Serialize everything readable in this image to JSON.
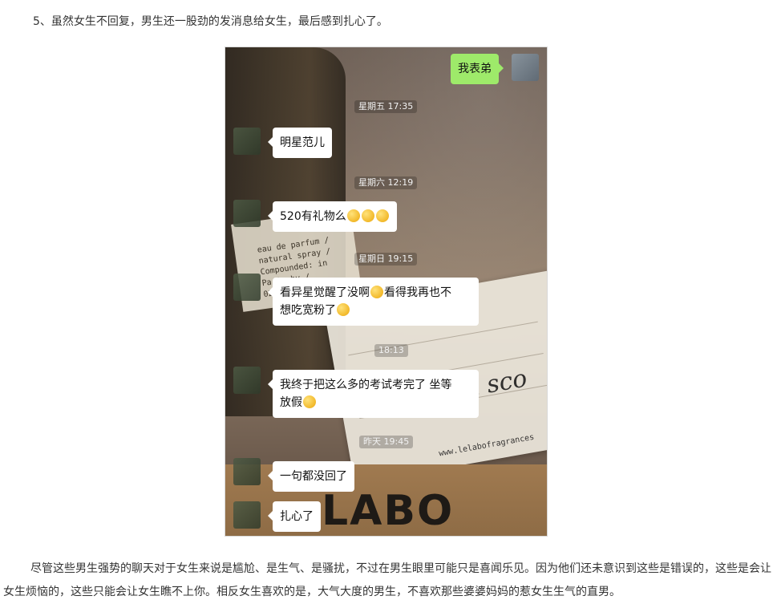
{
  "heading": "5、虽然女生不回复，男生还一股劲的发消息给女生，最后感到扎心了。",
  "chat": {
    "sent_message": "我表弟",
    "times": [
      "星期五 17:35",
      "星期六 12:19",
      "星期日 19:15",
      "18:13",
      "昨天 19:45"
    ],
    "messages": [
      {
        "text": "明星范儿"
      },
      {
        "text": "520有礼物么",
        "emoji_count": 3
      },
      {
        "line1": "看异星觉醒了没啊",
        "line1_tail": "看得我再也不",
        "line2": "想吃宽粉了"
      },
      {
        "line1": "我终于把这么多的考试考完了 坐等",
        "line2": "放假"
      },
      {
        "text": "一句都没回了"
      },
      {
        "text": "扎心了"
      }
    ],
    "emoji_icon": "laughing-crying-emoji-icon"
  },
  "background_text": {
    "bottle_label": "eau de parfum / natural spray / Compounded: in Paris by / 02/08/16",
    "box_word": "LABO",
    "card_script": "you sco",
    "url": "www.lelabofragrances"
  },
  "paragraph": "尽管这些男生强势的聊天对于女生来说是尴尬、是生气、是骚扰，不过在男生眼里可能只是喜闻乐见。因为他们还未意识到这些是错误的，这些是会让女生烦恼的，这些只能会让女生瞧不上你。相反女生喜欢的是，大气大度的男生，不喜欢那些婆婆妈妈的惹女生生气的直男。"
}
